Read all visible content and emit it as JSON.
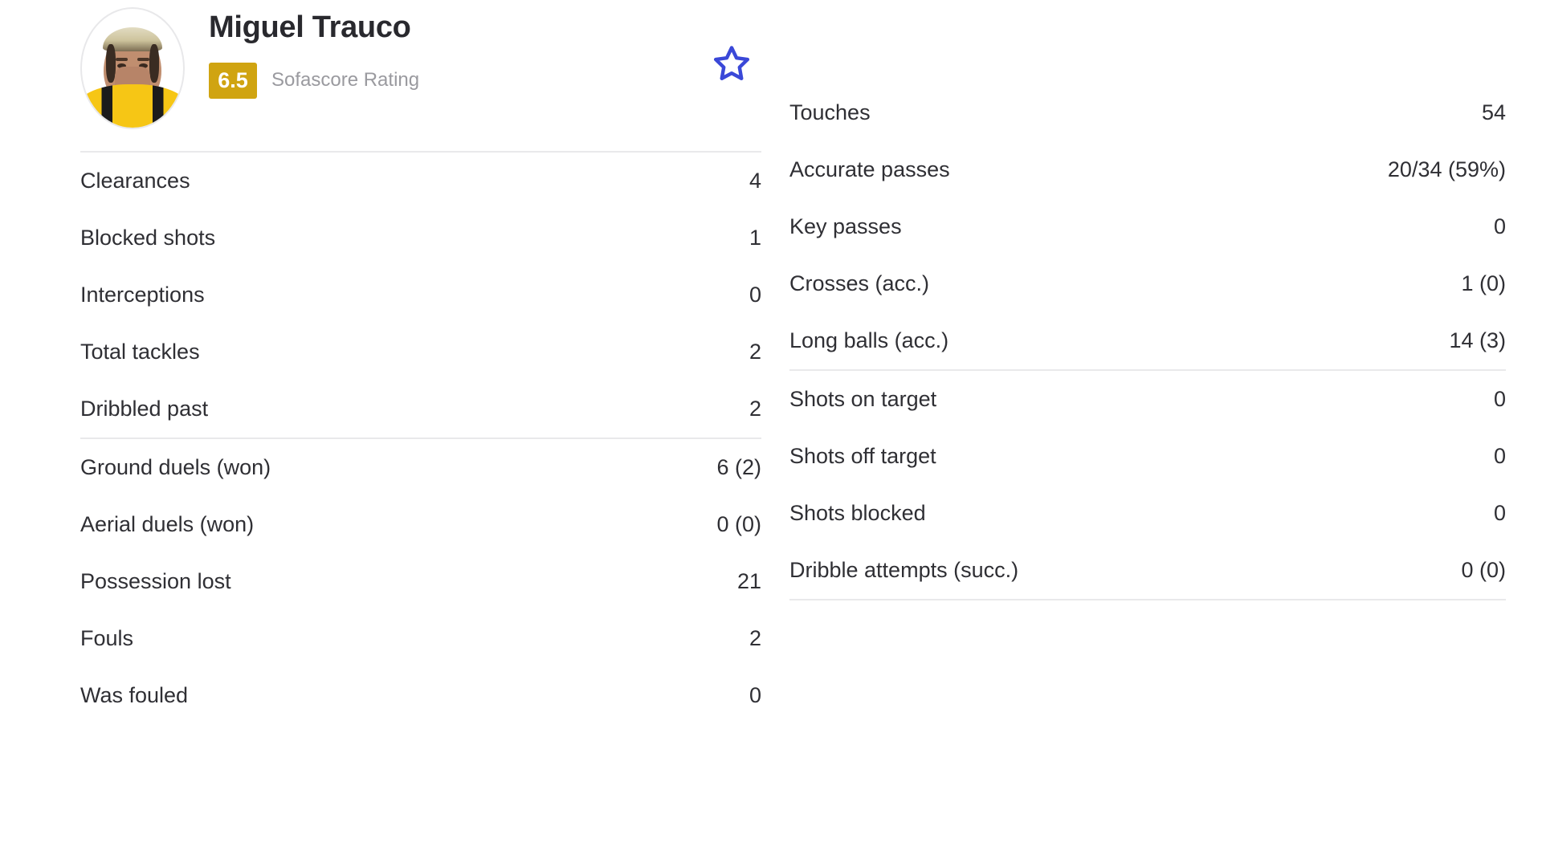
{
  "player": {
    "name": "Miguel Trauco",
    "rating": "6.5",
    "rating_label": "Sofascore Rating",
    "avatar_name": "player-avatar",
    "favorite_icon": "star-outline-icon",
    "favorite_color": "#3a48d8",
    "rating_badge_color": "#d0a411"
  },
  "left_column": {
    "groups": [
      {
        "rows": [
          {
            "label": "Clearances",
            "value": "4"
          },
          {
            "label": "Blocked shots",
            "value": "1"
          },
          {
            "label": "Interceptions",
            "value": "0"
          },
          {
            "label": "Total tackles",
            "value": "2"
          },
          {
            "label": "Dribbled past",
            "value": "2"
          }
        ]
      },
      {
        "rows": [
          {
            "label": "Ground duels (won)",
            "value": "6 (2)"
          },
          {
            "label": "Aerial duels (won)",
            "value": "0 (0)"
          },
          {
            "label": "Possession lost",
            "value": "21"
          },
          {
            "label": "Fouls",
            "value": "2"
          },
          {
            "label": "Was fouled",
            "value": "0"
          }
        ]
      }
    ]
  },
  "right_column": {
    "groups": [
      {
        "rows": [
          {
            "label": "Touches",
            "value": "54"
          },
          {
            "label": "Accurate passes",
            "value": "20/34 (59%)"
          },
          {
            "label": "Key passes",
            "value": "0"
          },
          {
            "label": "Crosses (acc.)",
            "value": "1 (0)"
          },
          {
            "label": "Long balls (acc.)",
            "value": "14 (3)"
          }
        ]
      },
      {
        "rows": [
          {
            "label": "Shots on target",
            "value": "0"
          },
          {
            "label": "Shots off target",
            "value": "0"
          },
          {
            "label": "Shots blocked",
            "value": "0"
          },
          {
            "label": "Dribble attempts (succ.)",
            "value": "0 (0)"
          }
        ]
      }
    ]
  }
}
